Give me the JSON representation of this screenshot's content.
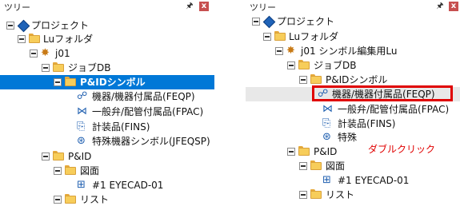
{
  "left": {
    "title": "ツリー",
    "pin": "🖈",
    "close": "x",
    "nodes": {
      "project": "プロジェクト",
      "folder": "Luフォルダ",
      "j01": "j01",
      "jobdb": "ジョブDB",
      "pidsym": "P&IDシンボル",
      "feqp": "機器/機器付属品(FEQP)",
      "fpac": "一般弁/配管付属品(FPAC)",
      "fins": "計装品(FINS)",
      "jfeqsp": "特殊機器シンボル(JFEQSP)",
      "pid": "P&ID",
      "zumen": "図面",
      "eyecad": "#1 EYECAD-01",
      "list": "リスト"
    }
  },
  "right": {
    "title": "ツリー",
    "pin": "🖈",
    "close": "x",
    "nodes": {
      "project": "プロジェクト",
      "folder": "Luフォルダ",
      "j01": "j01 シンボル編集用Lu",
      "jobdb": "ジョブDB",
      "pidsym": "P&IDシンボル",
      "feqp": "機器/機器付属品(FEQP)",
      "fpac": "一般弁/配管付属品(FPAC)",
      "fins": "計装品(FINS)",
      "jfeqsp": "特殊",
      "pid": "P&ID",
      "zumen": "図面",
      "eyecad": "#1 EYECAD-01",
      "list": "リスト"
    }
  },
  "annotation": "ダブルクリック",
  "colors": {
    "selection": "#0078d7",
    "highlight": "#e00000"
  },
  "icons": {
    "project": "diamond-icon",
    "folder": "folder-icon",
    "lu": "gear-folder-icon",
    "symbol": "symbol-icon",
    "drawing": "drawing-icon"
  }
}
